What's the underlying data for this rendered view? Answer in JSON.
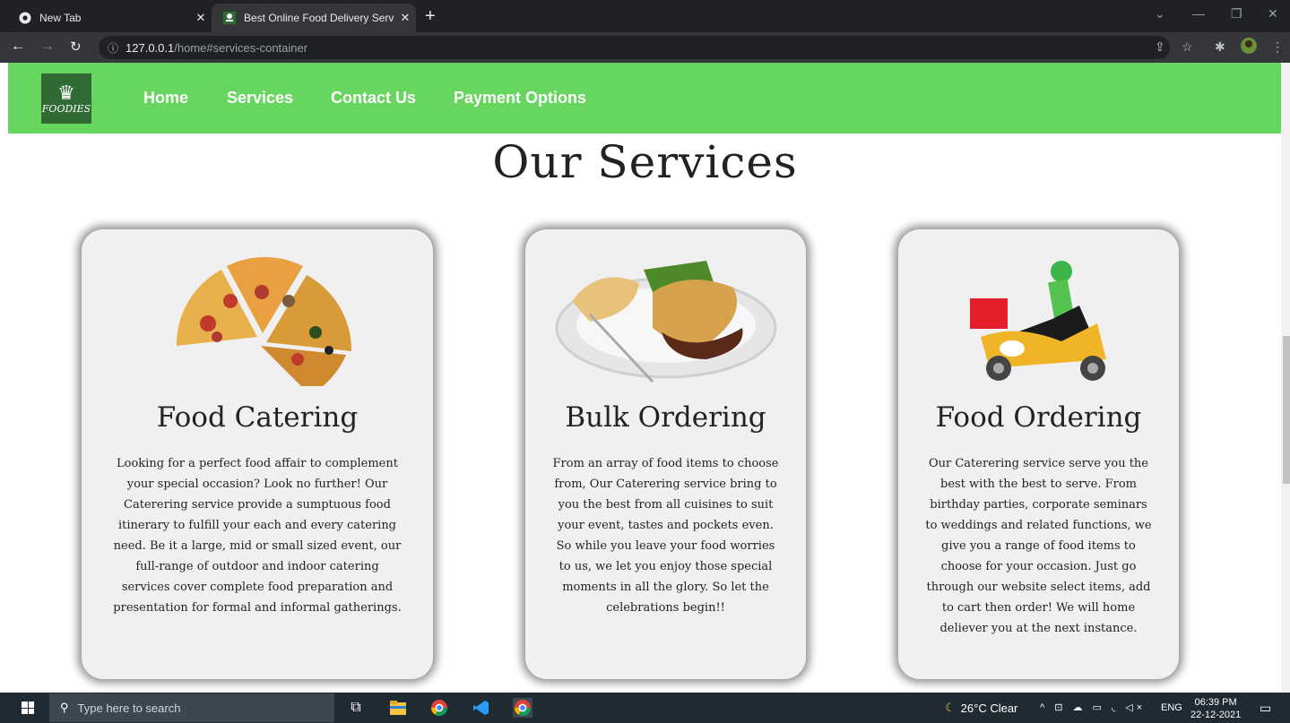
{
  "browser": {
    "tabs": [
      {
        "title": "New Tab",
        "icon": "chrome-icon"
      },
      {
        "title": "Best Online Food Delivery Servic",
        "icon": "foodies-favicon"
      }
    ],
    "url_host": "127.0.0.1",
    "url_path": "/home#services-container"
  },
  "site": {
    "logo_text": "FOODIES",
    "nav": [
      "Home",
      "Services",
      "Contact Us",
      "Payment Options"
    ],
    "heading": "Our Services",
    "cards": [
      {
        "title": "Food Catering",
        "image": "pizza-slices",
        "text": "Looking for a perfect food affair to complement your special occasion? Look no further! Our Caterering service provide a sumptuous food itinerary to fulfill your each and every catering need. Be it a large, mid or small sized event, our full-range of outdoor and indoor catering services cover complete food preparation and presentation for formal and informal gatherings."
      },
      {
        "title": "Bulk Ordering",
        "image": "pie-plate",
        "text": "From an array of food items to choose from, Our Caterering service bring to you the best from all cuisines to suit your event, tastes and pockets even. So while you leave your food worries to us, we let you enjoy those special moments in all the glory. So let the celebrations begin!!"
      },
      {
        "title": "Food Ordering",
        "image": "delivery-scooter",
        "text": "Our Caterering service serve you the best with the best to serve. From birthday parties, corporate seminars to weddings and related functions, we give you a range of food items to choose for your occasion. Just go through our website select items, add to cart then order! We will home deliever you at the next instance."
      }
    ]
  },
  "taskbar": {
    "search_placeholder": "Type here to search",
    "weather": "26°C Clear",
    "lang": "ENG",
    "time": "06:39 PM",
    "date": "22-12-2021"
  },
  "colors": {
    "navbar": "#67d65f",
    "logo_bg": "#2f6b32"
  }
}
